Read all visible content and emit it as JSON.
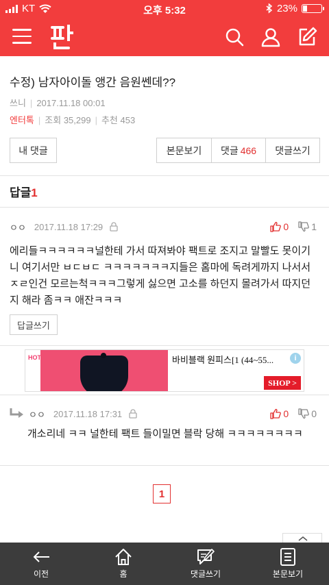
{
  "status_bar": {
    "carrier": "KT",
    "time": "오후 5:32",
    "battery": "23%",
    "battery_level": 0.23
  },
  "app_bar": {
    "logo": "판",
    "icons": [
      "menu-icon",
      "search-icon",
      "user-icon",
      "edit-icon"
    ]
  },
  "post": {
    "title": "수정) 남자아이돌 앵간 음원쎈데??",
    "author": "쓰니",
    "date": "2017.11.18 00:01",
    "category": "엔터톡",
    "views": "조회 35,299",
    "recommends": "추천 453"
  },
  "buttons": {
    "my_comments": "내 댓글",
    "view_post": "본문보기",
    "comments_label": "댓글",
    "comments_count": "466",
    "write_comment": "댓글쓰기"
  },
  "replies": {
    "label": "답글",
    "count": "1"
  },
  "comment": {
    "user": "ㅇㅇ",
    "date": "2017.11.18 17:29",
    "upvotes": "0",
    "downvotes": "1",
    "text": "에리들ㅋㅋㅋㅋㅋㅋ널한테 가서 따져봐야 팩트로 조지고 말빨도 못이기니 여기서만 ㅂㄷㅂㄷ ㅋㅋㅋㅋㅋㅋㅋ지들은 홈마에 독려게까지 나서서 ㅈㄹ인건 모르는척ㅋㅋㅋ그렇게 싫으면 고소를 하던지 몰려가서 따지던지 해라 좀ㅋㅋ 애잔ㅋㅋㅋ",
    "reply_button": "답글쓰기"
  },
  "ad": {
    "brand": "HOTPING",
    "text": "바비블랙 원피스[1 (44~55...",
    "info": "i",
    "shop": "SHOP >"
  },
  "reply": {
    "user": "ㅇㅇ",
    "date": "2017.11.18 17:31",
    "upvotes": "0",
    "downvotes": "0",
    "text": "개소리네 ㅋㅋ 널한테 팩트 들이밀면 블락 당해 ㅋㅋㅋㅋㅋㅋㅋㅋ"
  },
  "pagination": {
    "current": "1"
  },
  "tab_bar": {
    "items": [
      {
        "label": "이전",
        "icon": "back-arrow-icon"
      },
      {
        "label": "홈",
        "icon": "home-icon"
      },
      {
        "label": "댓글쓰기",
        "icon": "write-comment-icon"
      },
      {
        "label": "본문보기",
        "icon": "document-icon"
      }
    ]
  },
  "colors": {
    "accent": "#f23d3d",
    "tab_bar": "#3c3c3c"
  }
}
